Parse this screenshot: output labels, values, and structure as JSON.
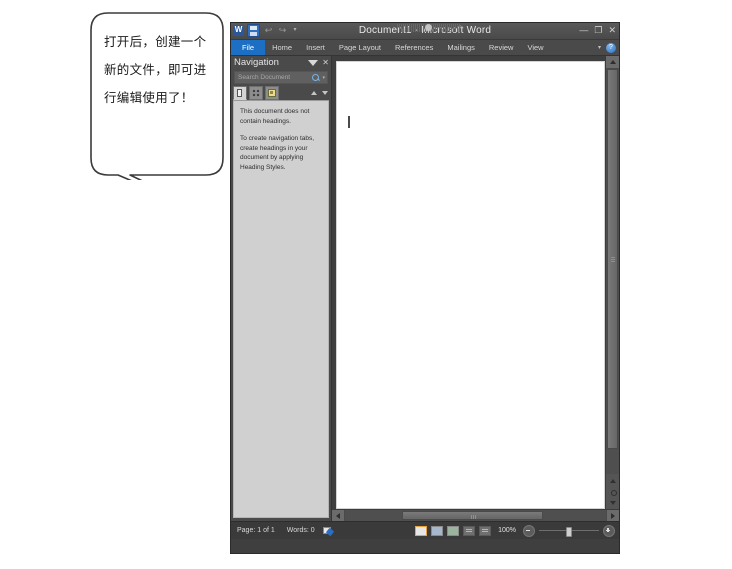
{
  "callout": {
    "text": "打开后，创建一个新的文件，即可进行编辑使用了！"
  },
  "window": {
    "title": "Document1 - Microsoft Word",
    "quick_access": {
      "app_icon": "word-app-icon",
      "save": "save-icon",
      "undo": "undo-icon",
      "redo": "redo-icon",
      "customize": "customize-quick-access-icon"
    },
    "controls": {
      "minimize": "—",
      "restore": "❐",
      "close": "✕"
    },
    "ribbon": {
      "tabs": [
        {
          "label": "File",
          "active": true
        },
        {
          "label": "Home",
          "active": false
        },
        {
          "label": "Insert",
          "active": false
        },
        {
          "label": "Page Layout",
          "active": false
        },
        {
          "label": "References",
          "active": false
        },
        {
          "label": "Mailings",
          "active": false
        },
        {
          "label": "Review",
          "active": false
        },
        {
          "label": "View",
          "active": false
        }
      ],
      "collapse_icon": "chevron-down-icon",
      "help_icon": "help-icon",
      "help_label": "?"
    }
  },
  "navigation": {
    "title": "Navigation",
    "dropdown_icon": "chevron-down-icon",
    "close_icon": "close-icon",
    "search": {
      "placeholder": "Search Document",
      "value": "",
      "search_icon": "search-icon",
      "options_icon": "chevron-down-icon"
    },
    "tabs": [
      {
        "name": "browse-headings-tab",
        "active": true
      },
      {
        "name": "browse-pages-tab",
        "active": false
      },
      {
        "name": "browse-results-tab",
        "active": false
      }
    ],
    "prev_icon": "triangle-up-icon",
    "next_icon": "triangle-down-icon",
    "messages": [
      "This document does not contain headings.",
      "To create navigation tabs, create headings in your document by applying Heading Styles."
    ]
  },
  "document": {
    "page_background": "#ffffff",
    "caret": "text-cursor"
  },
  "scrollbars": {
    "vertical": {
      "up_icon": "triangle-up-icon",
      "browse_prev_icon": "browse-previous-icon",
      "browse_object_icon": "select-browse-object-icon",
      "browse_next_icon": "browse-next-icon"
    },
    "horizontal": {
      "left_icon": "triangle-left-icon",
      "right_icon": "triangle-right-icon"
    }
  },
  "statusbar": {
    "page": "Page: 1 of 1",
    "words": "Words: 0",
    "proofing_icon": "proofing-errors-icon",
    "views": [
      {
        "name": "print-layout-view-button",
        "active": true
      },
      {
        "name": "full-screen-reading-view-button",
        "active": false
      },
      {
        "name": "web-layout-view-button",
        "active": false
      },
      {
        "name": "outline-view-button",
        "active": false
      },
      {
        "name": "draft-view-button",
        "active": false
      }
    ],
    "zoom_level": "100%",
    "zoom_out_icon": "zoom-out-icon",
    "zoom_in_icon": "zoom-in-icon",
    "zoom_slider": "zoom-slider"
  },
  "colors": {
    "file_tab": "#1d6fc4",
    "title_bar": "#4a4a4a",
    "nav_pane_body": "#d0d0d0",
    "active_view_outline": "#e8a33d",
    "window_chrome": "#3f3f3f"
  }
}
